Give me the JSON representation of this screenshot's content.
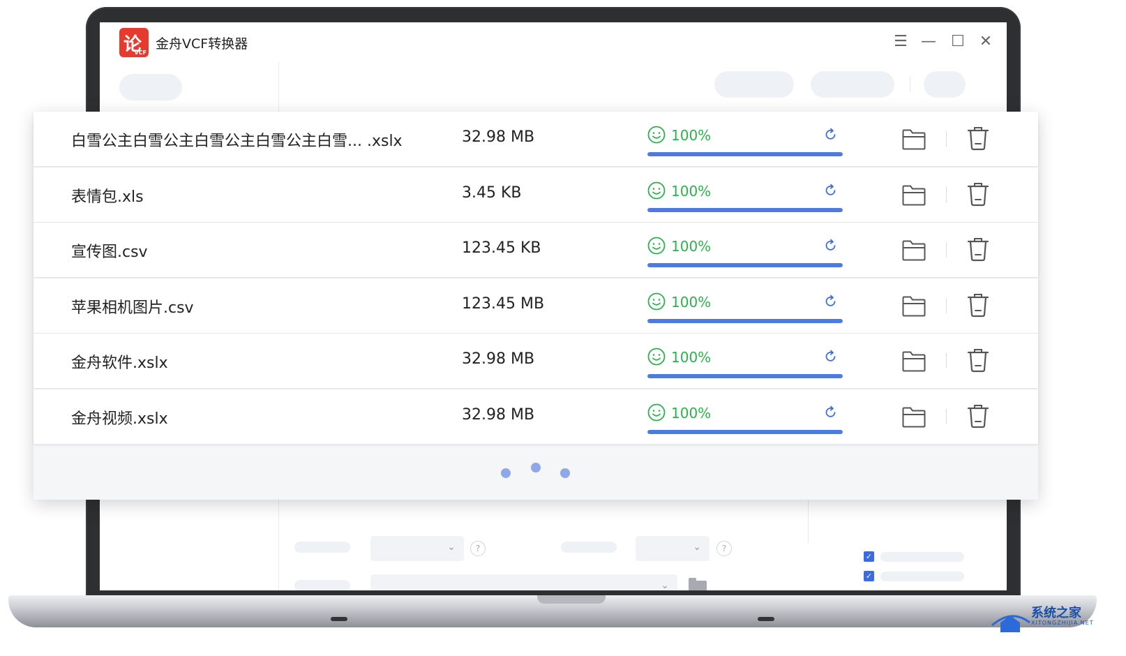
{
  "app": {
    "title": "金舟VCF转换器",
    "logo_glyph": "论",
    "logo_sub": "VCF",
    "brand_color": "#e63a2e"
  },
  "window_controls": {
    "menu_icon": "☰",
    "minimize_icon": "—",
    "maximize_icon": "☐",
    "close_icon": "✕"
  },
  "files": [
    {
      "name": "白雪公主白雪公主白雪公主白雪公主白雪... .xslx",
      "size": "32.98 MB",
      "progress": "100%",
      "progress_value": 100
    },
    {
      "name": "表情包.xls",
      "size": "3.45 KB",
      "progress": "100%",
      "progress_value": 100
    },
    {
      "name": "宣传图.csv",
      "size": "123.45 KB",
      "progress": "100%",
      "progress_value": 100
    },
    {
      "name": "苹果相机图片.csv",
      "size": "123.45 MB",
      "progress": "100%",
      "progress_value": 100
    },
    {
      "name": "金舟软件.xslx",
      "size": "32.98 MB",
      "progress": "100%",
      "progress_value": 100
    },
    {
      "name": "金舟视频.xslx",
      "size": "32.98 MB",
      "progress": "100%",
      "progress_value": 100
    }
  ],
  "settings_skeleton": {
    "help_glyph": "?",
    "chevron": "⌄",
    "check_glyph": "✓"
  },
  "colors": {
    "success": "#2bb24c",
    "progress": "#4c7be1",
    "loading_dots": "#8fa8e8"
  },
  "watermark": {
    "text": "系统之家",
    "sub": "XITONGZHIJIA.NET"
  }
}
